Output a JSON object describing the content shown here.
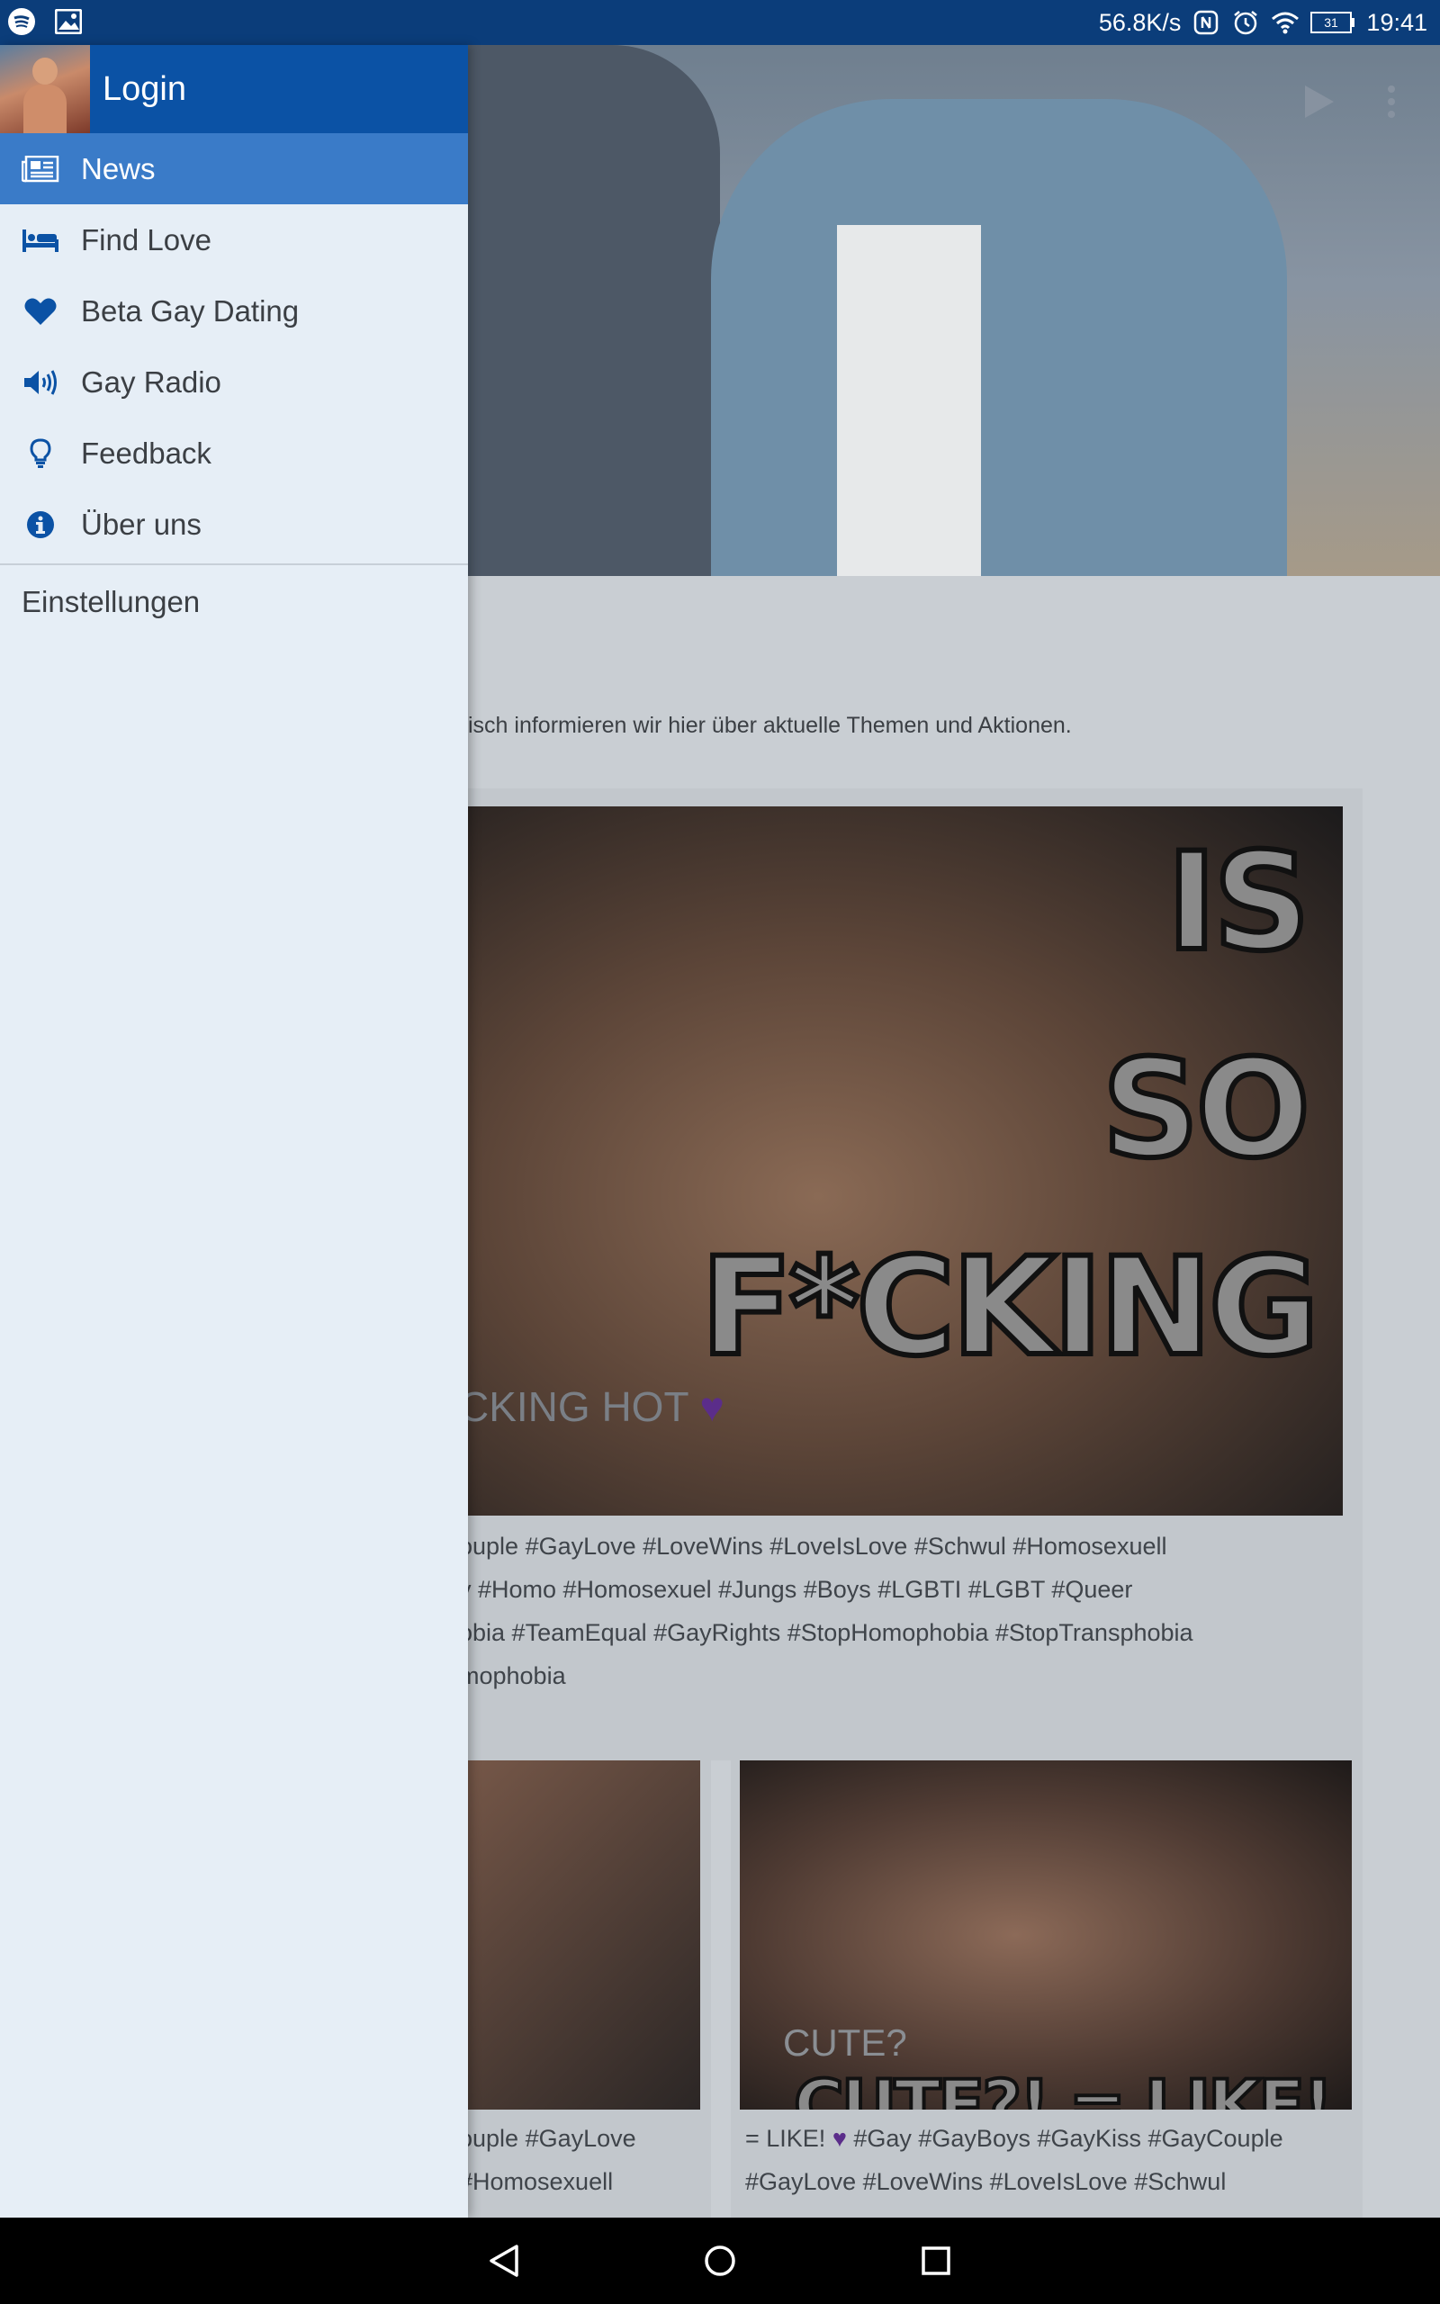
{
  "status_bar": {
    "speed": "56.8K/s",
    "battery": "31",
    "time": "19:41",
    "left_icons": [
      "spotify-icon",
      "image-icon"
    ],
    "right_icons": [
      "nfc-icon",
      "alarm-icon",
      "wifi-icon",
      "battery-icon"
    ]
  },
  "drawer": {
    "login_label": "Login",
    "items": [
      {
        "label": "News",
        "icon": "newspaper-icon",
        "active": true
      },
      {
        "label": "Find Love",
        "icon": "bed-icon",
        "active": false
      },
      {
        "label": "Beta Gay Dating",
        "icon": "heart-icon",
        "active": false
      },
      {
        "label": "Gay Radio",
        "icon": "speaker-icon",
        "active": false
      },
      {
        "label": "Feedback",
        "icon": "lightbulb-icon",
        "active": false
      },
      {
        "label": "Über uns",
        "icon": "info-icon",
        "active": false
      }
    ],
    "settings_label": "Einstellungen",
    "accent_color": "#0b52a5",
    "active_color": "#3a7bc8"
  },
  "content": {
    "toolbar_icons": [
      "play-icon",
      "more-vert-icon"
    ],
    "intro_text": "isch informieren wir hier über aktuelle Themen und Aktionen.",
    "post1": {
      "meme_lines": [
        "IS",
        "SO",
        "F*CKING"
      ],
      "caption_overlay": "CKING HOT",
      "hashtags": [
        "ouple #GayLove #LoveWins #LoveIsLove #Schwul #Homosexuell",
        "y #Homo #Homosexuel #Jungs #Boys #LGBTI #LGBT #Queer",
        "obia #TeamEqual #GayRights #StopHomophobia #StopTransphobia",
        "mophobia"
      ]
    },
    "post2": {
      "text_lines": [
        "ouple #GayLove",
        " #Homosexuell"
      ]
    },
    "post3": {
      "meme_small": "CUTE?",
      "meme_big": "CUTE?! = LIKE!",
      "text_prefix": "= LIKE!",
      "text_line1_suffix": " #Gay #GayBoys #GayKiss #GayCouple",
      "text_line2": "#GayLove #LoveWins #LoveIsLove #Schwul"
    }
  },
  "nav_bar": {
    "buttons": [
      "back-icon",
      "home-icon",
      "recents-icon"
    ]
  }
}
